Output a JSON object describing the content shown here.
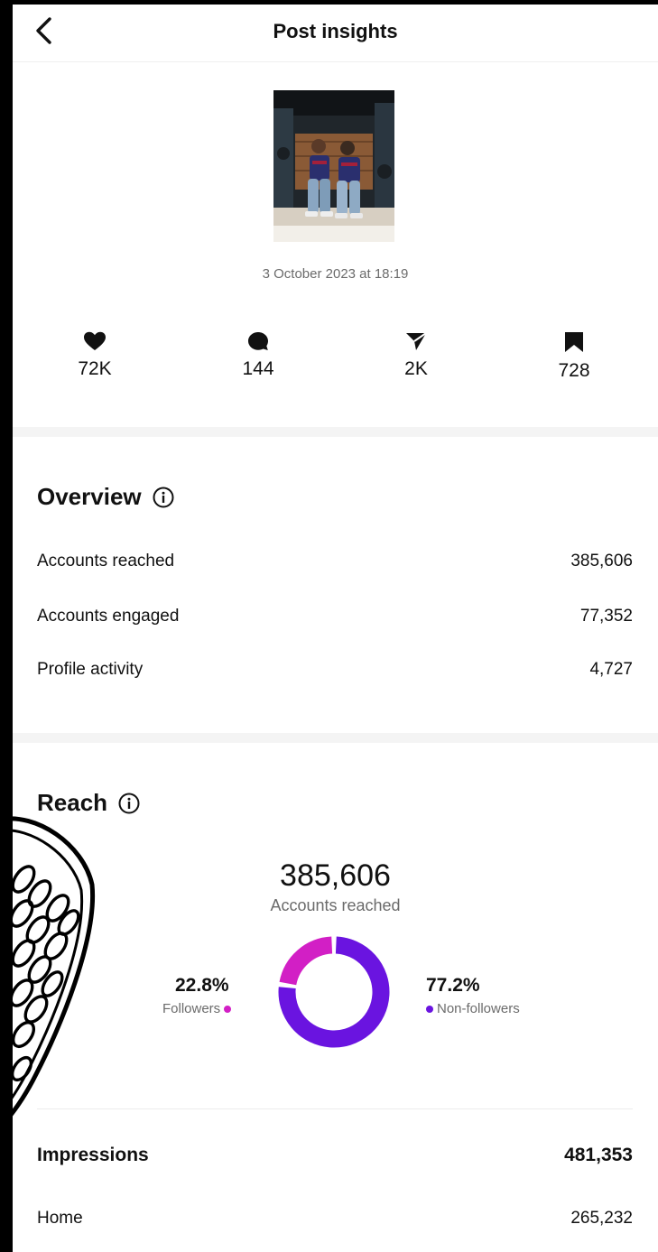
{
  "header": {
    "title": "Post insights"
  },
  "post": {
    "date": "3 October 2023 at 18:19"
  },
  "stats": [
    {
      "icon": "heart-icon",
      "value": "72K"
    },
    {
      "icon": "comment-icon",
      "value": "144"
    },
    {
      "icon": "share-icon",
      "value": "2K"
    },
    {
      "icon": "bookmark-icon",
      "value": "728"
    }
  ],
  "overview": {
    "title": "Overview",
    "rows": [
      {
        "label": "Accounts reached",
        "value": "385,606"
      },
      {
        "label": "Accounts engaged",
        "value": "77,352"
      },
      {
        "label": "Profile activity",
        "value": "4,727"
      }
    ]
  },
  "reach": {
    "title": "Reach",
    "total": "385,606",
    "total_label": "Accounts reached",
    "followers_pct": "22.8%",
    "followers_label": "Followers",
    "nonfollowers_pct": "77.2%",
    "nonfollowers_label": "Non-followers",
    "followers_fraction": 0.228,
    "followers_color": "#d21fc5",
    "nonfollowers_color": "#6a14e0"
  },
  "impressions": {
    "label": "Impressions",
    "value": "481,353",
    "rows": [
      {
        "label": "Home",
        "value": "265,232"
      }
    ]
  }
}
